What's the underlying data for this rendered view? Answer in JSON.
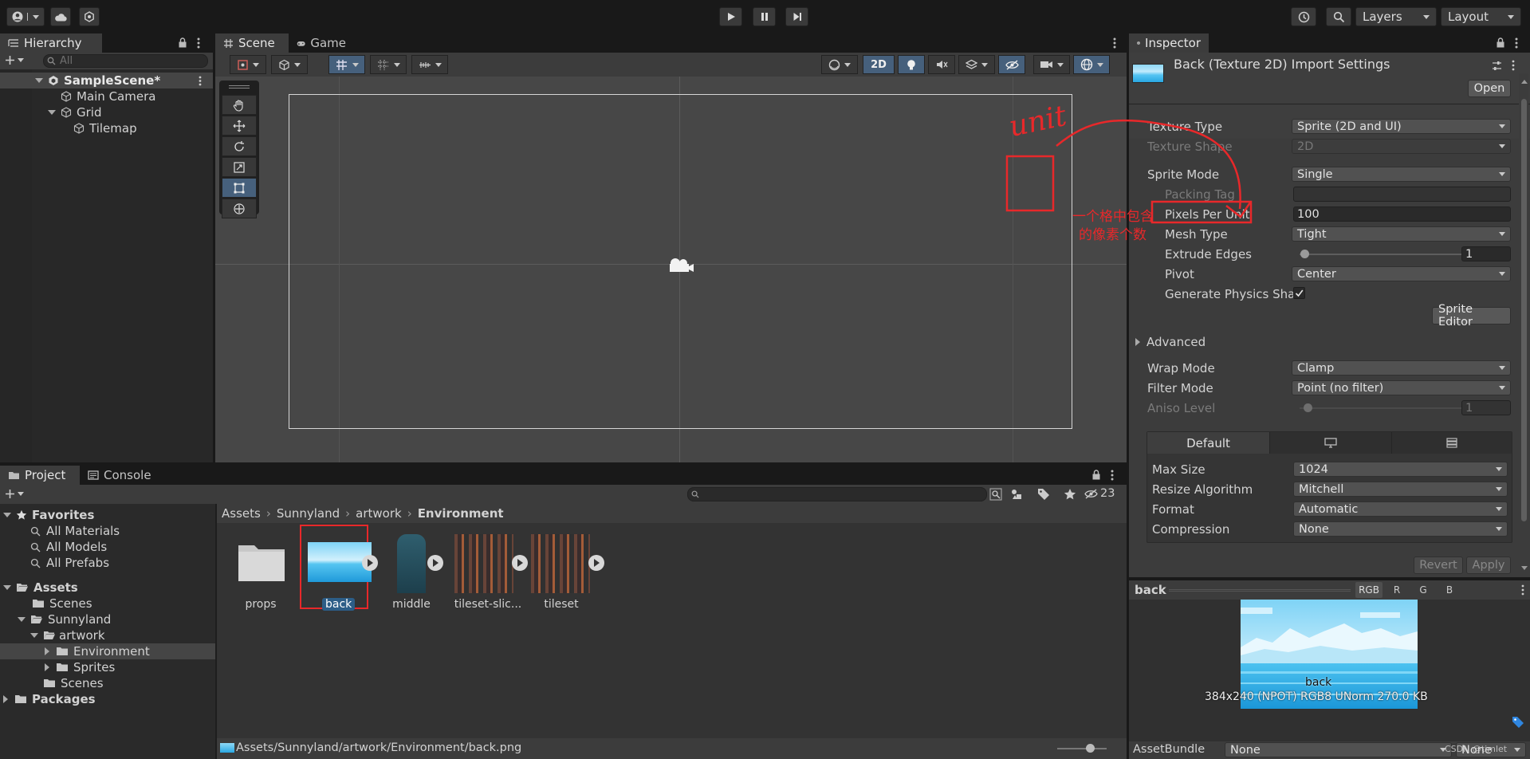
{
  "toolbar": {
    "layers_label": "Layers",
    "layout_label": "Layout"
  },
  "hierarchy": {
    "tab_label": "Hierarchy",
    "search_placeholder": "All",
    "scene_name": "SampleScene*",
    "items": [
      "Main Camera",
      "Grid",
      "Tilemap"
    ]
  },
  "scene": {
    "tabs": [
      "Scene",
      "Game"
    ],
    "mode_2d_label": "2D"
  },
  "annotation": {
    "word": "unit",
    "note_line1": "一个格中包含",
    "note_line2": "的像素个数"
  },
  "project": {
    "tabs": [
      "Project",
      "Console"
    ],
    "hidden_count": "23",
    "favorites_label": "Favorites",
    "favorites": [
      "All Materials",
      "All Models",
      "All Prefabs"
    ],
    "tree": {
      "assets": "Assets",
      "scenes": "Scenes",
      "sunnyland": "Sunnyland",
      "artwork": "artwork",
      "environment": "Environment",
      "sprites": "Sprites",
      "scenes2": "Scenes",
      "packages": "Packages"
    },
    "breadcrumb": [
      "Assets",
      "Sunnyland",
      "artwork",
      "Environment"
    ],
    "files": [
      "props",
      "back",
      "middle",
      "tileset-slic...",
      "tileset"
    ],
    "status_path": "Assets/Sunnyland/artwork/Environment/back.png"
  },
  "inspector": {
    "tab_label": "Inspector",
    "title": "Back (Texture 2D) Import Settings",
    "open_label": "Open",
    "texture_type_label": "Texture Type",
    "texture_type_value": "Sprite (2D and UI)",
    "texture_shape_label": "Texture Shape",
    "texture_shape_value": "2D",
    "sprite_mode_label": "Sprite Mode",
    "sprite_mode_value": "Single",
    "packing_tag_label": "Packing Tag",
    "packing_tag_value": "",
    "ppu_label": "Pixels Per Unit",
    "ppu_value": "100",
    "mesh_type_label": "Mesh Type",
    "mesh_type_value": "Tight",
    "extrude_label": "Extrude Edges",
    "extrude_value": "1",
    "pivot_label": "Pivot",
    "pivot_value": "Center",
    "physics_label": "Generate Physics Sha",
    "sprite_editor_label": "Sprite Editor",
    "advanced_label": "Advanced",
    "wrap_label": "Wrap Mode",
    "wrap_value": "Clamp",
    "filter_label": "Filter Mode",
    "filter_value": "Point (no filter)",
    "aniso_label": "Aniso Level",
    "aniso_value": "1",
    "platform_default": "Default",
    "max_size_label": "Max Size",
    "max_size_value": "1024",
    "resize_label": "Resize Algorithm",
    "resize_value": "Mitchell",
    "format_label": "Format",
    "format_value": "Automatic",
    "compression_label": "Compression",
    "compression_value": "None",
    "revert_label": "Revert",
    "apply_label": "Apply",
    "preview_name": "back",
    "channels": [
      "RGB",
      "R",
      "G",
      "B"
    ],
    "preview_caption": "back",
    "preview_info": "384x240 (NPOT)  RGB8 UNorm   270.0 KB",
    "assetbundle_label": "AssetBundle",
    "assetbundle_value": "None",
    "assetbundle_variant": "None",
    "watermark": "CSDN @timlet"
  },
  "colors": {
    "annotation_red": "#e8282a",
    "selection_blue": "#2c5d87",
    "sky_blue": "#4fc4f2"
  }
}
